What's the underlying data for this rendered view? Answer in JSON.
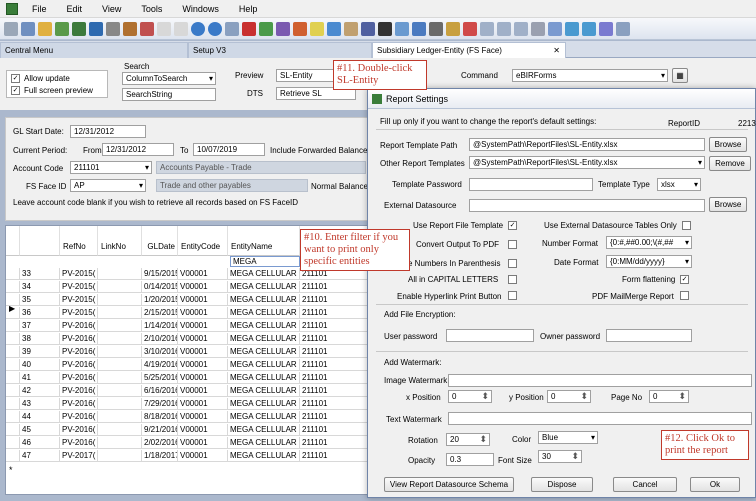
{
  "menu": [
    "File",
    "Edit",
    "View",
    "Tools",
    "Windows",
    "Help"
  ],
  "tabs": {
    "central_menu": "Central Menu",
    "setup": "Setup V3",
    "subsidiary": "Subsidiary Ledger-Entity (FS Face)",
    "close": "✕"
  },
  "left": {
    "allow_update": "Allow update",
    "full_screen": "Full screen preview",
    "search_label": "Search",
    "search_col": "ColumnToSearch",
    "search_string": "SearchString",
    "preview_label": "Preview",
    "preview_value": "SL-Entity",
    "dts_label": "DTS",
    "dts_value": "Retrieve SL",
    "command_label": "Command",
    "command_value": "eBIRForms",
    "gl_start_label": "GL Start Date:",
    "gl_start": "12/31/2012",
    "current_period_label": "Current Period:",
    "from_label": "From",
    "from": "12/31/2012",
    "to_label": "To",
    "to": "10/07/2019",
    "include_fwd": "Include Forwarded Balance",
    "account_code_label": "Account Code",
    "account_code": "211101",
    "account_name": "Accounts Payable - Trade",
    "fs_face_label": "FS Face ID",
    "fs_face": "AP",
    "fs_face_name": "Trade and other payables",
    "normal_balance": "Normal Balance",
    "hint": "Leave account code blank if you wish to retrieve all records based on FS FaceID"
  },
  "grid": {
    "columns": [
      "",
      "RefNo",
      "LinkNo",
      "GLDate",
      "EntityCode",
      "EntityName",
      ""
    ],
    "filter": "MEGA",
    "rows": [
      [
        "33",
        "PV-2015(",
        "",
        "9/15/2015",
        "V00001",
        "MEGA CELLULAR",
        "211101"
      ],
      [
        "34",
        "PV-2015(",
        "",
        "0/14/2015",
        "V00001",
        "MEGA CELLULAR",
        "211101"
      ],
      [
        "35",
        "PV-2015(",
        "",
        "1/20/2015",
        "V00001",
        "MEGA CELLULAR",
        "211101"
      ],
      [
        "36",
        "PV-2015(",
        "",
        "2/15/2015",
        "V00001",
        "MEGA CELLULAR",
        "211101"
      ],
      [
        "37",
        "PV-2016(",
        "",
        "1/14/2016",
        "V00001",
        "MEGA CELLULAR",
        "211101"
      ],
      [
        "38",
        "PV-2016(",
        "",
        "2/10/2016",
        "V00001",
        "MEGA CELLULAR",
        "211101"
      ],
      [
        "39",
        "PV-2016(",
        "",
        "3/10/2016",
        "V00001",
        "MEGA CELLULAR",
        "211101"
      ],
      [
        "40",
        "PV-2016(",
        "",
        "4/19/2016",
        "V00001",
        "MEGA CELLULAR",
        "211101"
      ],
      [
        "41",
        "PV-2016(",
        "",
        "5/25/2016",
        "V00001",
        "MEGA CELLULAR",
        "211101"
      ],
      [
        "42",
        "PV-2016(",
        "",
        "6/16/2016",
        "V00001",
        "MEGA CELLULAR",
        "211101"
      ],
      [
        "43",
        "PV-2016(",
        "",
        "7/29/2016",
        "V00001",
        "MEGA CELLULAR",
        "211101"
      ],
      [
        "44",
        "PV-2016(",
        "",
        "8/18/2016",
        "V00001",
        "MEGA CELLULAR",
        "211101"
      ],
      [
        "45",
        "PV-2016(",
        "",
        "9/21/2016",
        "V00001",
        "MEGA CELLULAR",
        "211101"
      ],
      [
        "46",
        "PV-2016(",
        "",
        "2/02/2016",
        "V00001",
        "MEGA CELLULAR",
        "211101"
      ],
      [
        "47",
        "PV-2017(",
        "",
        "1/18/2017",
        "V00001",
        "MEGA CELLULAR",
        "211101"
      ]
    ],
    "new_row": "*"
  },
  "dialog": {
    "title": "Report Settings",
    "intro": "Fill up only if you want to change the report's default settings:",
    "report_id_label": "ReportID",
    "report_id": "2213",
    "template_path_label": "Report Template Path",
    "template_path": "@SystemPath\\ReportFiles\\SL-Entity.xlsx",
    "other_templates_label": "Other Report Templates",
    "other_templates": "@SystemPath\\ReportFiles\\SL-Entity.xlsx",
    "browse": "Browse",
    "remove": "Remove",
    "template_password_label": "Template Password",
    "template_type_label": "Template Type",
    "template_type": "xlsx",
    "external_ds_label": "External Datasource",
    "use_report_file": "Use Report File Template",
    "use_external_tables": "Use External Datasource Tables Only",
    "convert_pdf": "Convert Output To PDF",
    "number_format_label": "Number Format",
    "number_format": "{0:#,##0.00;\\(#,##",
    "neg_paren": "e Numbers In Parenthesis",
    "date_format_label": "Date Format",
    "date_format": "{0:MM/dd/yyyy}",
    "all_caps": "All in CAPITAL LETTERS",
    "form_flattening": "Form flattening",
    "hyperlink": "Enable Hyperlink Print Button",
    "pdf_mailmerge": "PDF MailMerge Report",
    "add_encryption": "Add File Encryption:",
    "user_password_label": "User password",
    "owner_password_label": "Owner password",
    "add_watermark": "Add Watermark:",
    "image_watermark": "Image Watermark",
    "x_pos_label": "x Position",
    "x_pos": "0",
    "y_pos_label": "y Position",
    "y_pos": "0",
    "page_no_label": "Page No",
    "page_no": "0",
    "text_watermark": "Text Watermark",
    "rotation_label": "Rotation",
    "rotation": "20",
    "color_label": "Color",
    "color": "Blue",
    "opacity_label": "Opacity",
    "opacity": "0.3",
    "font_size_label": "Font Size",
    "font_size": "30",
    "view_schema": "View Report Datasource Schema",
    "dispose": "Dispose",
    "cancel": "Cancel",
    "ok": "Ok"
  },
  "callouts": {
    "c11": "#11. Double-click SL-Entity",
    "c10": "#10. Enter filter if you want to print only specific entities",
    "c12": "#12. Click Ok to print the report"
  },
  "colors": {
    "callout": "#c0392b",
    "toolbar_bg": "#dde4ef",
    "panel_bg": "#f0f0f0"
  }
}
